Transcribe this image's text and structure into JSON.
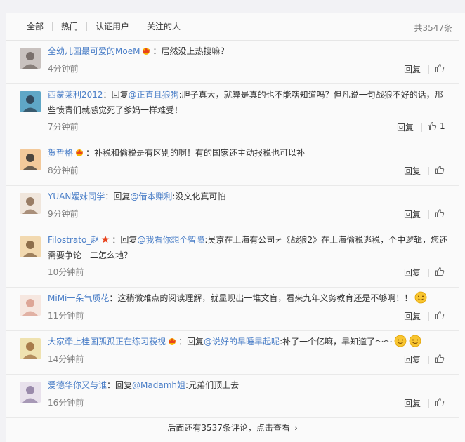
{
  "tabs": [
    "全部",
    "热门",
    "认证用户",
    "关注的人"
  ],
  "total": "共3547条",
  "reply_label": "回复",
  "comments": [
    {
      "user": "全幼儿园最可爱的MoeM",
      "badge": true,
      "sep": "：",
      "pre": "",
      "mention": "",
      "body": "居然没上热搜嘛？",
      "time": "4分钟前",
      "likes": ""
    },
    {
      "user": "西蒙莱利2012",
      "badge": false,
      "sep": "：",
      "pre": "回复",
      "mention": "@正直且狼狗",
      "body": ":胆子真大，就算是真的也不能嗐知道吗？但凡说一句战狼不好的话，那些愤青们就感觉死了爹妈一样难受！",
      "time": "7分钟前",
      "likes": "1"
    },
    {
      "user": "贺哲格",
      "badge": true,
      "sep": "：",
      "pre": "",
      "mention": "",
      "body": "补税和偷税是有区别的啊！有的国家还主动报税也可以补",
      "time": "8分钟前",
      "likes": ""
    },
    {
      "user": "YUAN嫒妹同学",
      "badge": false,
      "sep": "：",
      "pre": "回复",
      "mention": "@借本赚利",
      "body": ":没文化真可怕",
      "time": "9分钟前",
      "likes": ""
    },
    {
      "user": "Filostrato_赵",
      "badge": false,
      "star": true,
      "sep": "：",
      "pre": "回复",
      "mention": "@我看你想个智障",
      "body": ":吴京在上海有公司≠《战狼2》在上海偷税逃税，个中逻辑，您还需要争论一二怎么地？",
      "time": "10分钟前",
      "likes": ""
    },
    {
      "user": "MiMi一朵气质花",
      "badge": false,
      "sep": "：",
      "pre": "",
      "mention": "",
      "body": "这稍微难点的阅读理解，就显现出一堆文盲，看来九年义务教育还是不够啊！！",
      "time": "11分钟前",
      "likes": "",
      "emojis": 1
    },
    {
      "user": "大家牵上桂国孤孤正在练习藐视",
      "badge": true,
      "sep": "：",
      "pre": "回复",
      "mention": "@说好的早睡早起呢",
      "body": ":补了一个亿嘛，早知道了～～",
      "time": "14分钟前",
      "likes": "",
      "emojis": 2
    },
    {
      "user": "爱德华你又与谁",
      "badge": false,
      "sep": "：",
      "pre": "回复",
      "mention": "@Madamh姐",
      "body": ":兄弟们顶上去",
      "time": "16分钟前",
      "likes": ""
    }
  ],
  "more": "后面还有3537条评论，点击查看",
  "colors": {
    "link": "#4a7ec7",
    "bg": "#fafafa",
    "page": "#f2f2f5"
  },
  "icons": [
    "thumbs-up-icon",
    "crown-badge-icon",
    "star-icon",
    "emoji-icon",
    "chevron-right-icon"
  ]
}
